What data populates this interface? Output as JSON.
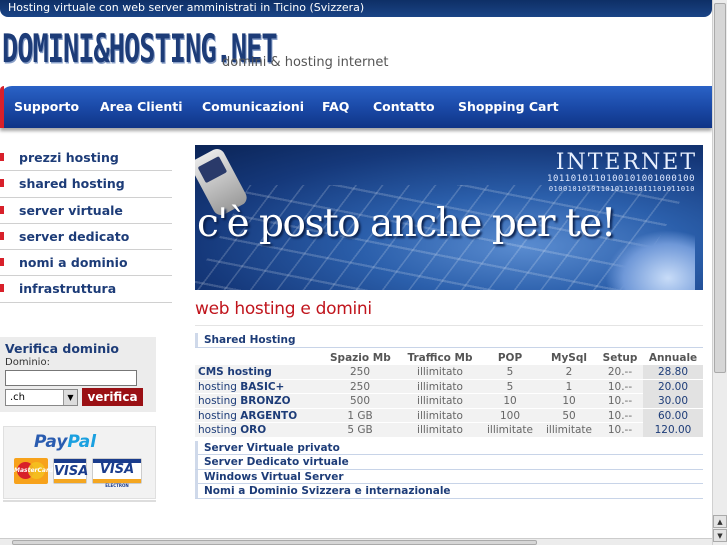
{
  "topbar": {
    "text": "Hosting virtuale con web server amministrati in Ticino (Svizzera)"
  },
  "header": {
    "logo": "DOMINI&HOSTING.NET",
    "tagline": "domini & hosting internet"
  },
  "nav": {
    "items": [
      "Supporto",
      "Area Clienti",
      "Comunicazioni",
      "FAQ",
      "Contatto",
      "Shopping Cart"
    ]
  },
  "sidebar": {
    "items": [
      "prezzi hosting",
      "shared hosting",
      "server virtuale",
      "server dedicato",
      "nomi a dominio",
      "infrastruttura"
    ]
  },
  "verifica": {
    "title": "Verifica dominio",
    "label": "Dominio:",
    "input_value": "",
    "tld": ".ch",
    "button": "verifica"
  },
  "paypal": {
    "logo_main": "Pay",
    "logo_accent": "Pal",
    "card1": "MasterCard",
    "card2": "VISA",
    "card3": "VISA",
    "card3_sub": "ELECTRON"
  },
  "banner": {
    "heading": "INTERNET",
    "binary1": "1011010110100101001000100",
    "binary2": "0100101010110101101011101011010",
    "slogan": "c'è posto anche per te!"
  },
  "content": {
    "title": "web hosting e domini",
    "category": "Shared Hosting",
    "columns": [
      "Spazio Mb",
      "Traffico Mb",
      "POP",
      "MySql",
      "Setup",
      "Annuale"
    ],
    "plans": [
      {
        "prefix": "",
        "name": "CMS hosting",
        "spazio": "250",
        "traffico": "illimitato",
        "pop": "5",
        "mysql": "2",
        "setup": "20.--",
        "annuale": "28.80"
      },
      {
        "prefix": "hosting ",
        "name": "BASIC+",
        "spazio": "250",
        "traffico": "illimitato",
        "pop": "5",
        "mysql": "1",
        "setup": "10.--",
        "annuale": "20.00"
      },
      {
        "prefix": "hosting ",
        "name": "BRONZO",
        "spazio": "500",
        "traffico": "illimitato",
        "pop": "10",
        "mysql": "10",
        "setup": "10.--",
        "annuale": "30.00"
      },
      {
        "prefix": "hosting ",
        "name": "ARGENTO",
        "spazio": "1 GB",
        "traffico": "illimitato",
        "pop": "100",
        "mysql": "50",
        "setup": "10.--",
        "annuale": "60.00"
      },
      {
        "prefix": "hosting ",
        "name": "ORO",
        "spazio": "5 GB",
        "traffico": "illimitato",
        "pop": "illimitate",
        "mysql": "illimitate",
        "setup": "10.--",
        "annuale": "120.00"
      }
    ],
    "links": [
      "Server Virtuale privato",
      "Server Dedicato virtuale",
      "Windows Virtual Server",
      "Nomi a Dominio Svizzera e internazionale"
    ]
  }
}
